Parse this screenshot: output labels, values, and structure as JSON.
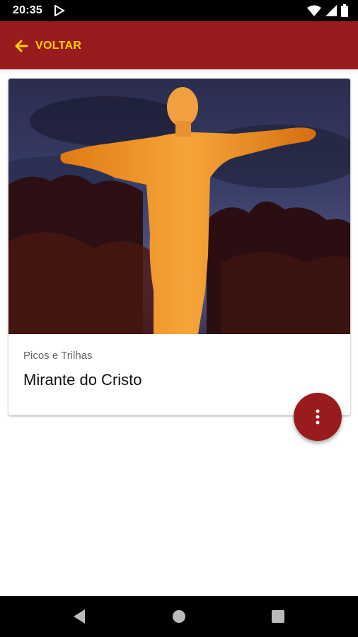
{
  "status_bar": {
    "time": "20:35",
    "icons": [
      "play-store-icon",
      "wifi-icon",
      "signal-icon",
      "battery-icon"
    ]
  },
  "app_bar": {
    "back_label": "VOLTAR",
    "background_color": "#981b1e",
    "accent_color": "#ffd200"
  },
  "card": {
    "category": "Picos e Trilhas",
    "title": "Mirante do Cristo"
  },
  "fab": {
    "icon": "more-vert-icon"
  },
  "nav_bar": {
    "buttons": [
      "back-triangle-icon",
      "home-circle-icon",
      "recents-square-icon"
    ]
  }
}
